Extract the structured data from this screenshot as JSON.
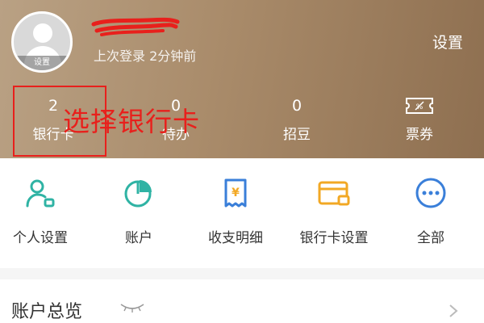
{
  "header": {
    "avatar_badge": "设置",
    "last_login": "上次登录 2分钟前",
    "settings_label": "设置"
  },
  "stats": [
    {
      "value": "2",
      "label": "银行卡"
    },
    {
      "value": "0",
      "label": "待办"
    },
    {
      "value": "0",
      "label": "招豆"
    },
    {
      "value": "",
      "label": "票券",
      "icon": "ticket-icon"
    }
  ],
  "annotation": {
    "text": "选择银行卡",
    "color": "#e8201c"
  },
  "menu": [
    {
      "label": "个人设置",
      "icon": "person-settings-icon",
      "color": "#2fb3a4"
    },
    {
      "label": "账户",
      "icon": "pie-chart-icon",
      "color": "#2fb3a4"
    },
    {
      "label": "收支明细",
      "icon": "yen-receipt-icon",
      "color": "#3a7fd9"
    },
    {
      "label": "银行卡设置",
      "icon": "card-settings-icon",
      "color": "#f2a824"
    },
    {
      "label": "全部",
      "icon": "more-dots-icon",
      "color": "#3a7fd9"
    }
  ],
  "overview": {
    "title": "账户总览"
  },
  "colors": {
    "header_start": "#b9a184",
    "header_end": "#8e6f50",
    "annotation": "#e8201c"
  }
}
